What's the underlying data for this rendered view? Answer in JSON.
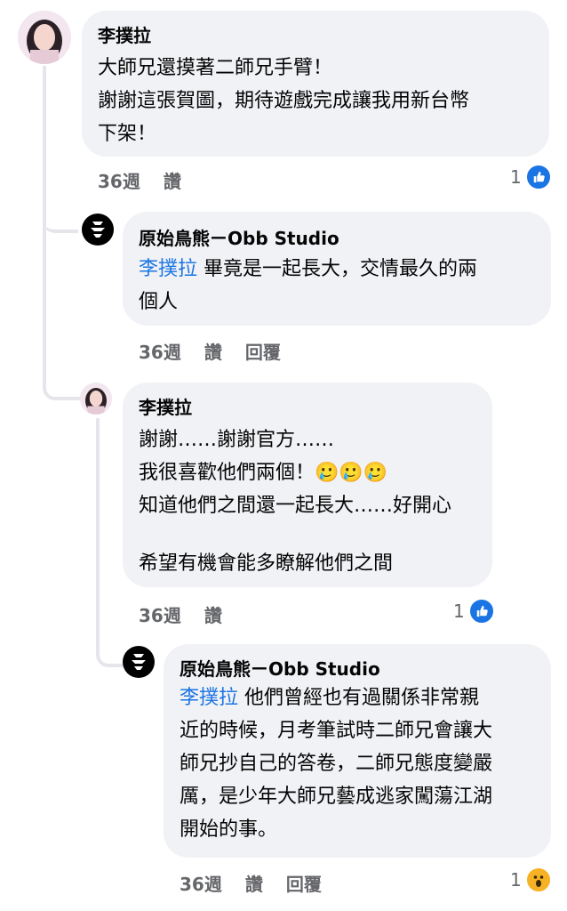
{
  "comments": [
    {
      "author": "李撲拉",
      "lines": [
        "大師兄還摸著二師兄手臂！",
        "謝謝這張賀圖，期待遊戲完成讓我用新台幣",
        "下架！"
      ],
      "time": "36週",
      "like": "讚",
      "reaction_count": "1"
    },
    {
      "author": "原始鳥熊ㄧObb Studio",
      "mention": "李撲拉",
      "lines": [
        " 畢竟是一起長大，交情最久的兩",
        "個人"
      ],
      "time": "36週",
      "like": "讚",
      "reply": "回覆"
    },
    {
      "author": "李撲拉",
      "lines": [
        "謝謝……謝謝官方……",
        "我很喜歡他們兩個！",
        "知道他們之間還一起長大……好開心",
        "",
        "希望有機會能多瞭解他們之間"
      ],
      "emojis": "🥲🥲🥲",
      "time": "36週",
      "like": "讚",
      "reaction_count": "1"
    },
    {
      "author": "原始鳥熊ㄧObb Studio",
      "mention": "李撲拉",
      "lines": [
        " 他們曾經也有過關係非常親",
        "近的時候，月考筆試時二師兄會讓大",
        "師兄抄自己的答卷，二師兄態度變嚴",
        "厲，是少年大師兄藝成逃家闖蕩江湖",
        "開始的事。"
      ],
      "time": "36週",
      "like": "讚",
      "reply": "回覆",
      "reaction_count": "1"
    }
  ],
  "icons": {
    "like": "thumbs-up-icon",
    "wow": "wow-face-icon",
    "studio_logo": "studio-logo-icon"
  },
  "colors": {
    "bubble": "#f0f2f5",
    "mention": "#1b74e4",
    "meta": "#65676b",
    "like_blue": "#1b74e4",
    "wow_yellow": "#f7b125"
  }
}
